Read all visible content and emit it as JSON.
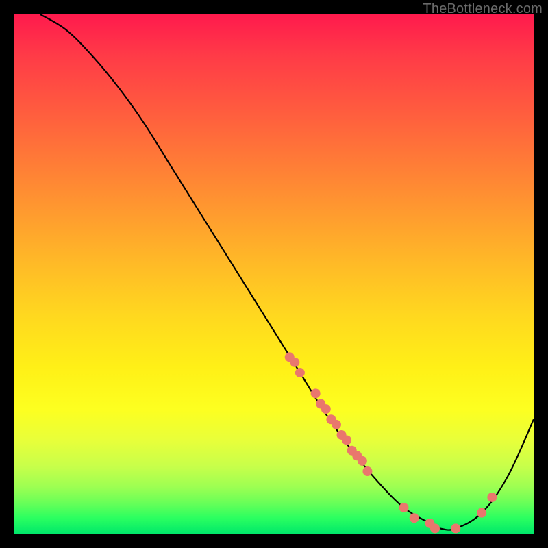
{
  "watermark": "TheBottleneck.com",
  "colors": {
    "bg": "#000000",
    "curve": "#000000",
    "marker": "#e9776d"
  },
  "chart_data": {
    "type": "line",
    "title": "",
    "xlabel": "",
    "ylabel": "",
    "xlim": [
      0,
      100
    ],
    "ylim": [
      0,
      100
    ],
    "curve": {
      "x": [
        5,
        10,
        15,
        20,
        25,
        30,
        35,
        40,
        45,
        50,
        55,
        60,
        65,
        70,
        75,
        80,
        82,
        85,
        90,
        95,
        100
      ],
      "y": [
        100,
        97,
        92,
        86,
        79,
        71,
        63,
        55,
        47,
        39,
        31,
        23,
        16,
        10,
        5,
        2,
        1,
        1,
        4,
        11,
        22
      ]
    },
    "markers": [
      {
        "x": 53,
        "y": 34
      },
      {
        "x": 54,
        "y": 33
      },
      {
        "x": 55,
        "y": 31
      },
      {
        "x": 58,
        "y": 27
      },
      {
        "x": 59,
        "y": 25
      },
      {
        "x": 60,
        "y": 24
      },
      {
        "x": 61,
        "y": 22
      },
      {
        "x": 62,
        "y": 21
      },
      {
        "x": 63,
        "y": 19
      },
      {
        "x": 64,
        "y": 18
      },
      {
        "x": 65,
        "y": 16
      },
      {
        "x": 66,
        "y": 15
      },
      {
        "x": 67,
        "y": 14
      },
      {
        "x": 68,
        "y": 12
      },
      {
        "x": 75,
        "y": 5
      },
      {
        "x": 77,
        "y": 3
      },
      {
        "x": 80,
        "y": 2
      },
      {
        "x": 81,
        "y": 1
      },
      {
        "x": 85,
        "y": 1
      },
      {
        "x": 90,
        "y": 4
      },
      {
        "x": 92,
        "y": 7
      }
    ]
  }
}
